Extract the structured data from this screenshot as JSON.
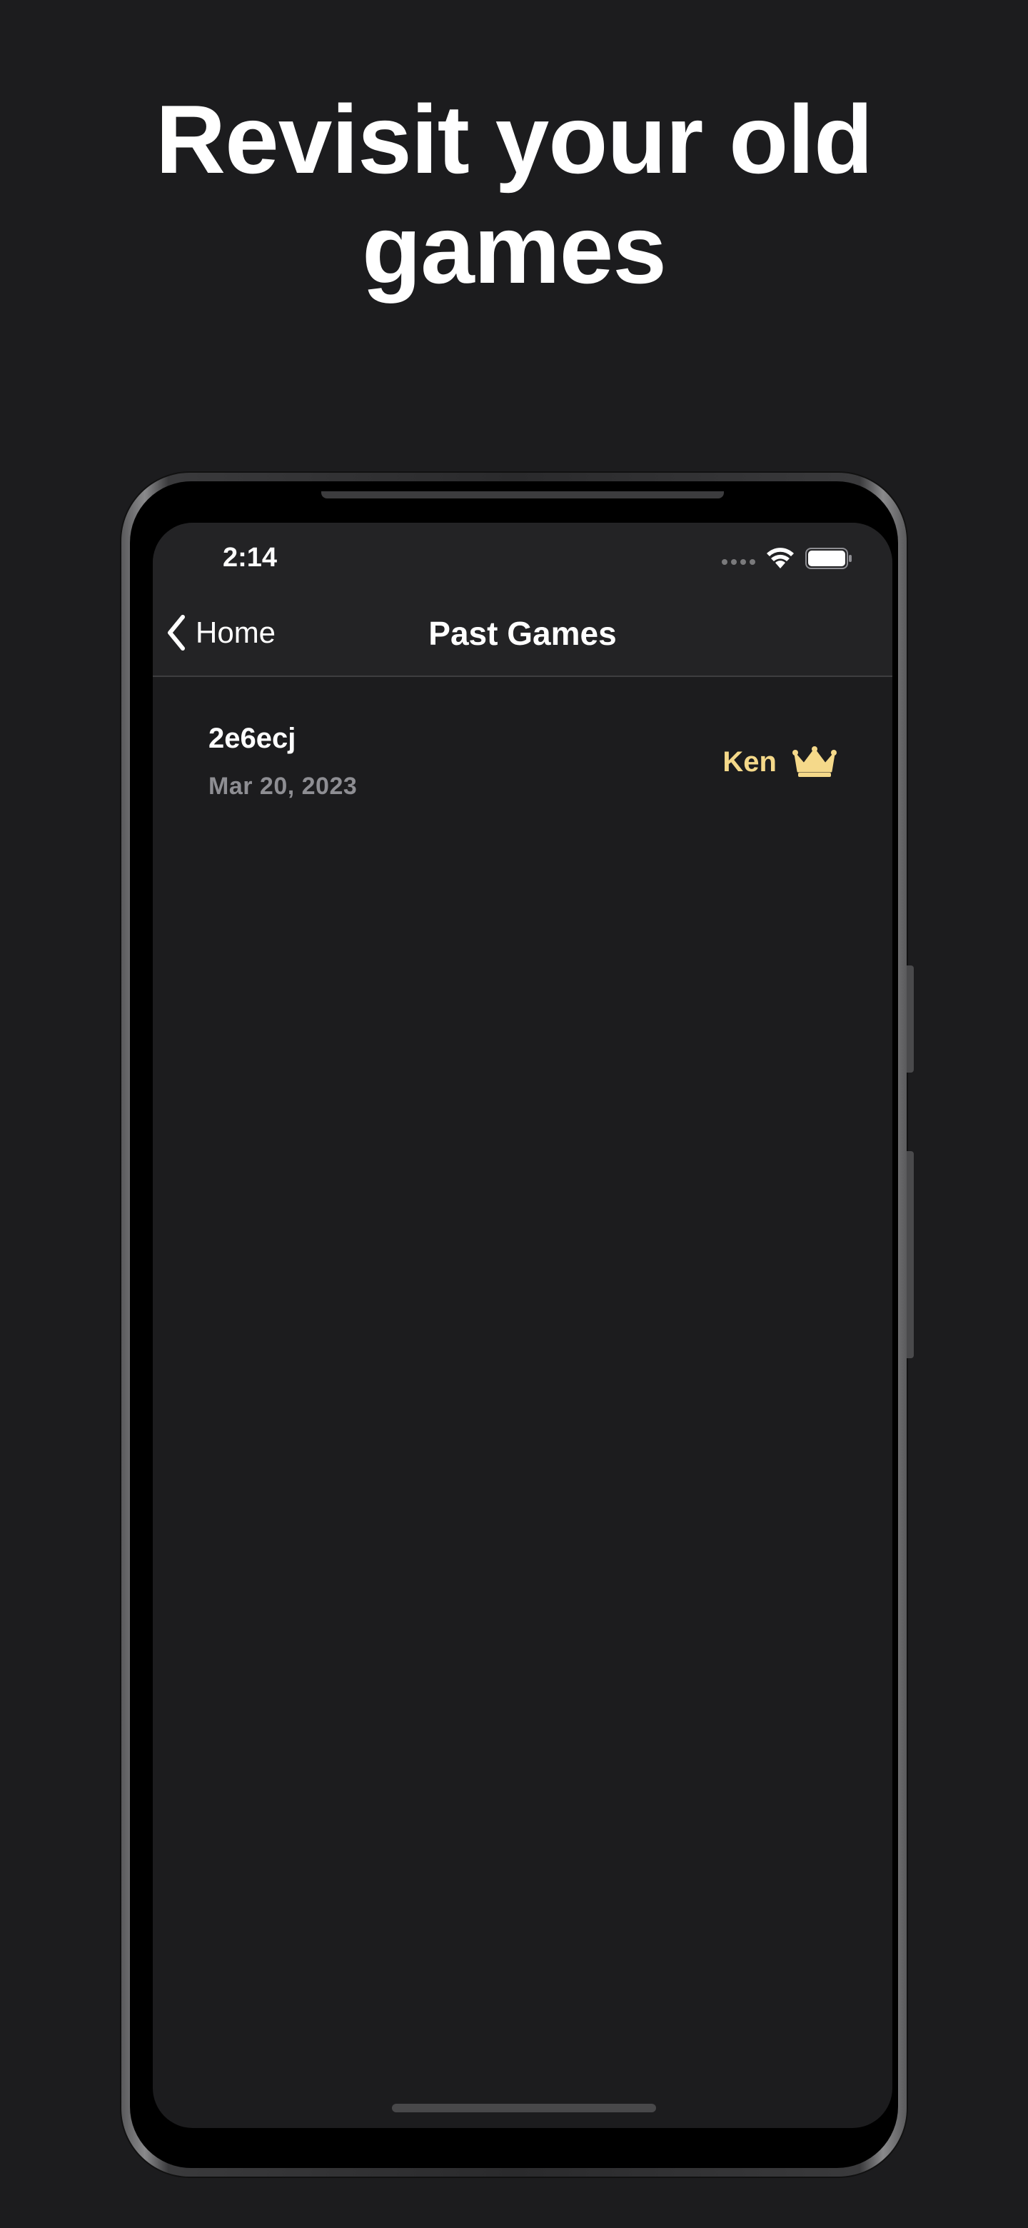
{
  "headline": {
    "line1": "Revisit your old",
    "line2": "games"
  },
  "status_bar": {
    "time": "2:14",
    "icons": [
      "signal-dots-icon",
      "wifi-icon",
      "battery-icon"
    ]
  },
  "nav": {
    "back_label": "Home",
    "back_icon": "chevron-left-icon",
    "title": "Past Games"
  },
  "games": [
    {
      "id": "2e6ecj",
      "date": "Mar 20, 2023",
      "winner": "Ken",
      "winner_icon": "crown-icon"
    }
  ],
  "colors": {
    "background": "#1c1c1e",
    "winner_accent": "#f5d98a",
    "secondary_text": "#8e8e93"
  }
}
